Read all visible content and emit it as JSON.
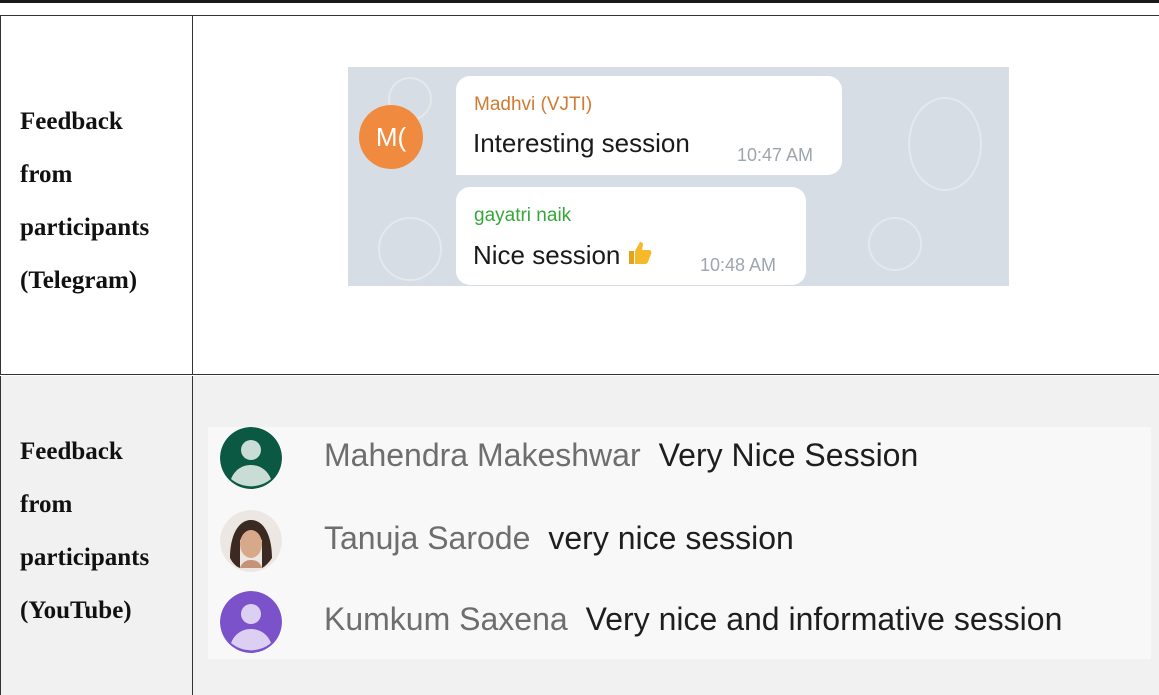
{
  "rows": [
    {
      "label": "Feedback\nfrom\nparticipants\n(Telegram)",
      "messages": [
        {
          "avatar_initials": "M(",
          "sender": "Madhvi (VJTI)",
          "text": "Interesting session",
          "time": "10:47 AM",
          "sender_color": "#d07a32"
        },
        {
          "sender": "gayatri naik",
          "text": "Nice session",
          "emoji": "thumbs-up-icon",
          "time": "10:48 AM",
          "sender_color": "#37a73b"
        }
      ]
    },
    {
      "label": "Feedback\nfrom\nparticipants\n(YouTube)",
      "comments": [
        {
          "name": "Mahendra Makeshwar",
          "text": "Very Nice Session",
          "avatar_color": "#0b5843"
        },
        {
          "name": "Tanuja Sarode",
          "text": "very nice session",
          "avatar": "photo"
        },
        {
          "name": "Kumkum Saxena",
          "text": "Very nice and informative session",
          "avatar_color": "#7b52c9"
        }
      ]
    }
  ]
}
